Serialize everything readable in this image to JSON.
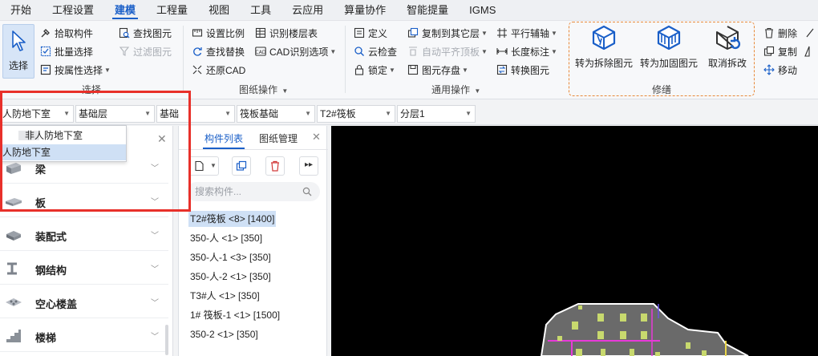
{
  "menu": [
    "开始",
    "工程设置",
    "建模",
    "工程量",
    "视图",
    "工具",
    "云应用",
    "算量协作",
    "智能提量",
    "IGMS"
  ],
  "ribbon": {
    "select_group": {
      "select_label": "选择",
      "pick": "拾取构件",
      "batch": "批量选择",
      "by_attr": "按属性选择",
      "find": "查找图元",
      "filter": "过滤图元",
      "group_label": "选择"
    },
    "drawing_group": {
      "set_scale": "设置比例",
      "find_replace": "查找替换",
      "restore_cad": "还原CAD",
      "identify_floor": "识别楼层表",
      "cad_options": "CAD识别选项",
      "group_label": "图纸操作"
    },
    "common_group": {
      "define": "定义",
      "cloud_check": "云检查",
      "lock": "锁定",
      "copy_to_floor": "复制到其它层",
      "auto_align": "自动平齐顶板",
      "save_element": "图元存盘",
      "parallel_axis": "平行辅轴",
      "length_mark": "长度标注",
      "convert_element": "转换图元",
      "group_label": "通用操作"
    },
    "fix_group": {
      "to_demolish": "转为拆除图元",
      "to_reinforce": "转为加固图元",
      "cancel_demolish": "取消拆改",
      "group_label": "修缮"
    },
    "edit_group": {
      "delete": "删除",
      "copy": "复制",
      "move": "移动"
    }
  },
  "layerbar": {
    "floor": "人防地下室",
    "level": "基础层",
    "type": "基础",
    "subtype": "筏板基础",
    "component": "T2#筏板",
    "layer": "分层1"
  },
  "dropdown": {
    "options": [
      "非人防地下室",
      "人防地下室"
    ],
    "selected_index": 1
  },
  "categories": [
    "梁",
    "板",
    "装配式",
    "钢结构",
    "空心楼盖",
    "楼梯"
  ],
  "mid_panel": {
    "tab_components": "构件列表",
    "tab_drawings": "图纸管理",
    "search_placeholder": "搜索构件...",
    "components": [
      "T2#筏板 <8> [1400]",
      "350-人 <1> [350]",
      "350-人-1 <3> [350]",
      "350-人-2 <1> [350]",
      "T3#人 <1> [350]",
      "1# 筏板-1 <1> [1500]",
      "350-2 <1> [350]"
    ],
    "selected_index": 0
  },
  "colors": {
    "accent": "#1a5fc8",
    "highlight_frame": "#e8302a",
    "fix_frame": "#e8893a",
    "canvas_bg": "#000000",
    "slab_fill": "#6a6a6a",
    "column_fill": "#c8d96e",
    "beam_magenta": "#e83ad8",
    "axis_yellow": "#e8d54a"
  },
  "icons": {
    "select": "cursor-arrow-icon",
    "demolish": "cube-demolish-icon",
    "reinforce": "cube-reinforce-icon",
    "cancel": "cube-undo-icon"
  }
}
